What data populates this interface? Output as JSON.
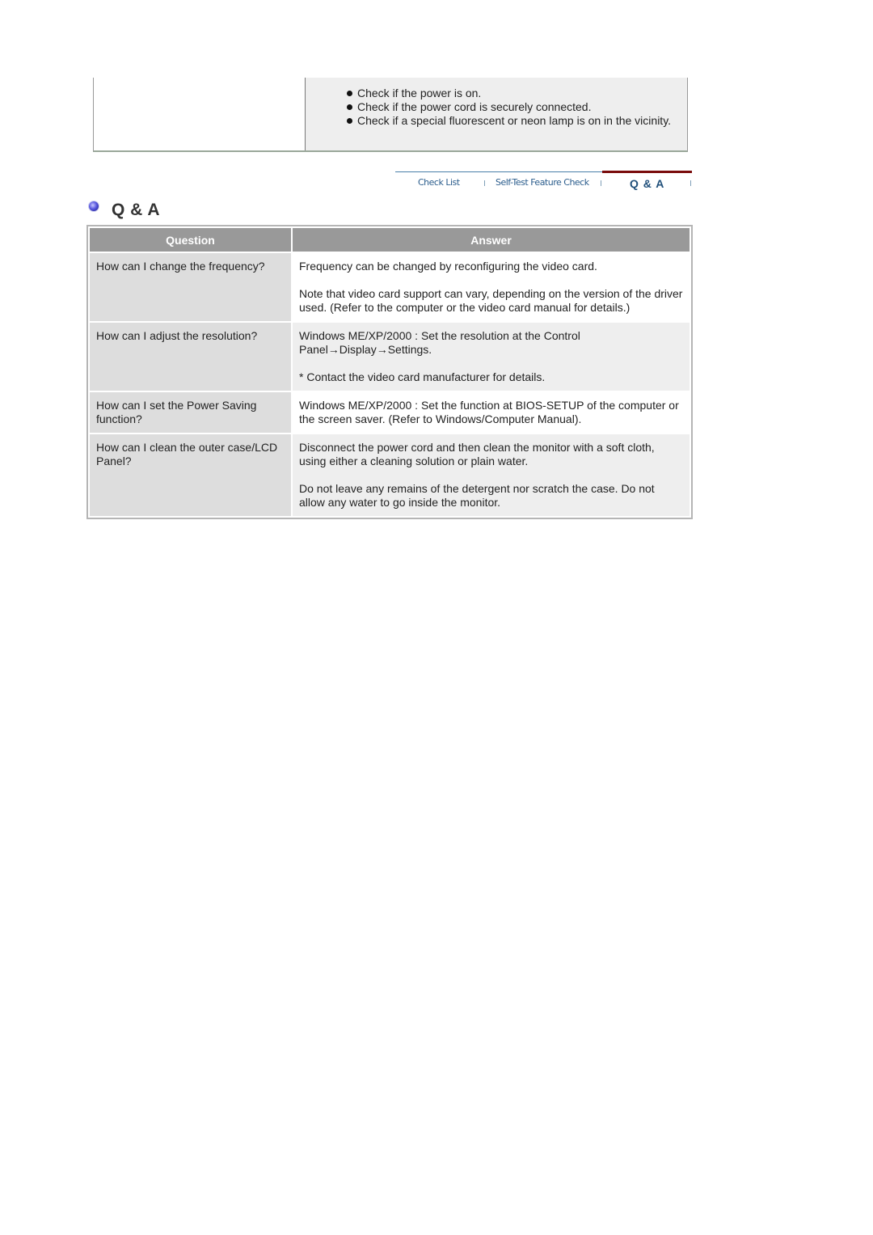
{
  "top_section": {
    "checklist": [
      "Check if the power is on.",
      "Check if the power cord is securely connected.",
      "Check if a special fluorescent or neon lamp is on in the vicinity."
    ]
  },
  "nav": {
    "tabs": [
      {
        "label": "Check List",
        "active": false
      },
      {
        "label": "Self-Test Feature Check",
        "active": false
      },
      {
        "label": "Q & A",
        "active": true
      }
    ],
    "active_color": "#7a0c0c"
  },
  "section": {
    "title": "Q & A",
    "icon": "blue-bullet-icon"
  },
  "qa_table": {
    "headers": {
      "question": "Question",
      "answer": "Answer"
    },
    "rows": [
      {
        "question": "How can I change the frequency?",
        "answer": [
          "Frequency can be changed by reconfiguring the video card.",
          "Note that video card support can vary, depending on the version of the driver used. (Refer to the computer or the video card manual for details.)"
        ]
      },
      {
        "question": "How can I adjust the resolution?",
        "answer": [
          "Windows ME/XP/2000 : Set the resolution at the Control Panel→Display→Settings.",
          "* Contact the video card manufacturer for details."
        ]
      },
      {
        "question": "How can I set the Power Saving function?",
        "answer": [
          "Windows ME/XP/2000 : Set the function at BIOS-SETUP of the computer or the screen saver. (Refer to Windows/Computer Manual)."
        ]
      },
      {
        "question": "How can I clean the outer case/LCD Panel?",
        "answer": [
          "Disconnect the power cord and then clean the monitor with a soft cloth, using either a cleaning solution or plain water.",
          "Do not leave any remains of the detergent nor scratch the case. Do not allow any water to go inside the monitor."
        ]
      }
    ]
  }
}
